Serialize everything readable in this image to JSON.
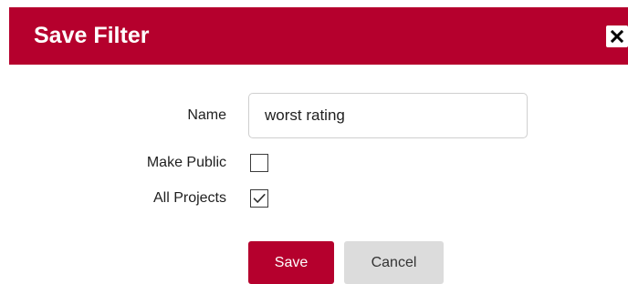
{
  "dialog": {
    "title": "Save Filter",
    "close_icon": "close-icon"
  },
  "form": {
    "name_label": "Name",
    "name_value": "worst rating",
    "make_public_label": "Make Public",
    "make_public_checked": false,
    "all_projects_label": "All Projects",
    "all_projects_checked": true
  },
  "buttons": {
    "save_label": "Save",
    "cancel_label": "Cancel"
  },
  "colors": {
    "accent": "#b5002d",
    "cancel_bg": "#dcdcdc"
  }
}
